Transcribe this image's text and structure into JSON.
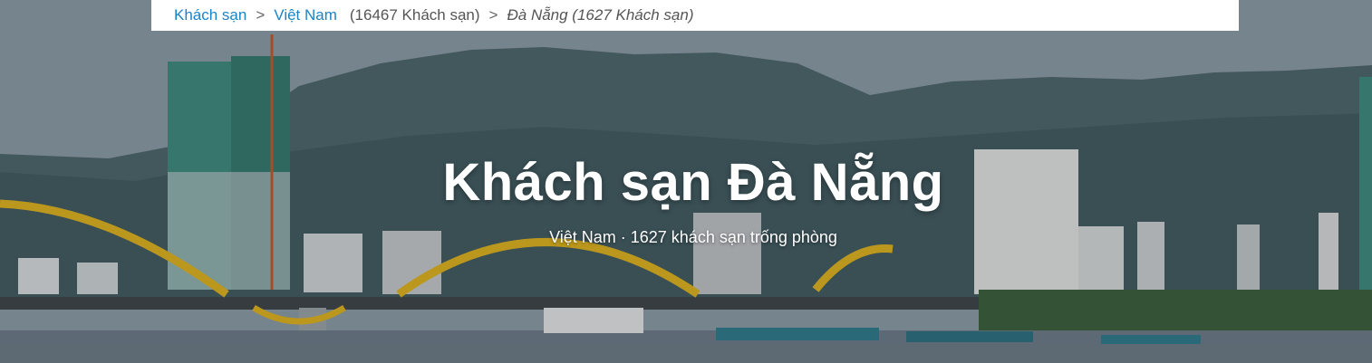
{
  "breadcrumb": {
    "home_label": "Khách sạn",
    "sep1": ">",
    "country_label": "Việt Nam",
    "country_count": "(16467 Khách sạn)",
    "sep2": ">",
    "current_label": "Đà Nẵng (1627 Khách sạn)"
  },
  "hero": {
    "title": "Khách sạn Đà Nẵng",
    "subtitle": "Việt Nam · 1627 khách sạn trống phòng"
  },
  "colors": {
    "link": "#1a84c7",
    "bridge": "#e0b21c",
    "water": "#6d7b85",
    "mountain": "#3f5a5e"
  }
}
